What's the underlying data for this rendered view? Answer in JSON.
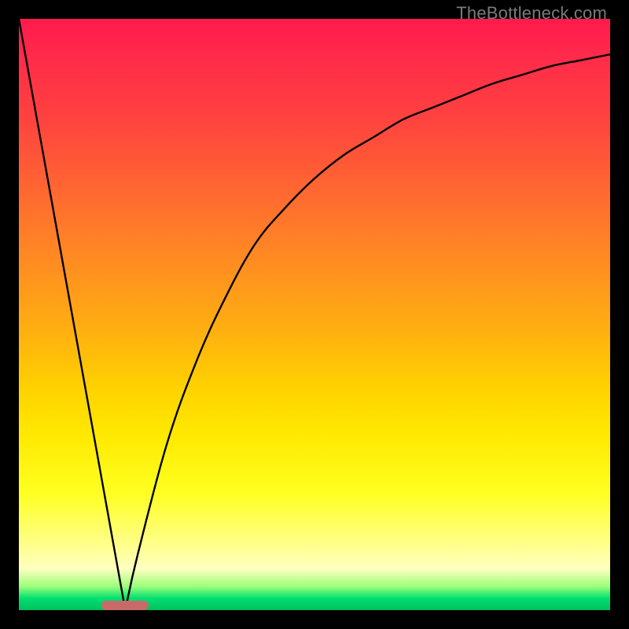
{
  "watermark": {
    "text": "TheBottleneck.com"
  },
  "chart_data": {
    "type": "line",
    "title": "",
    "xlabel": "",
    "ylabel": "",
    "xlim": [
      0,
      100
    ],
    "ylim": [
      0,
      100
    ],
    "grid": false,
    "legend": false,
    "background": "red-yellow-green vertical gradient",
    "marker": {
      "x_start": 14,
      "x_end": 22,
      "y": 0,
      "color": "#c96a6a"
    },
    "series": [
      {
        "name": "left-descending-line",
        "x": [
          0,
          18
        ],
        "y": [
          100,
          0
        ]
      },
      {
        "name": "right-rising-curve",
        "x": [
          18,
          20,
          25,
          30,
          35,
          40,
          45,
          50,
          55,
          60,
          65,
          70,
          75,
          80,
          85,
          90,
          95,
          100
        ],
        "y": [
          0,
          9,
          28,
          42,
          53,
          62,
          68,
          73,
          77,
          80,
          83,
          85,
          87,
          89,
          90.5,
          92,
          93,
          94
        ]
      }
    ]
  },
  "colors": {
    "curve": "#000000",
    "frame": "#000000"
  }
}
